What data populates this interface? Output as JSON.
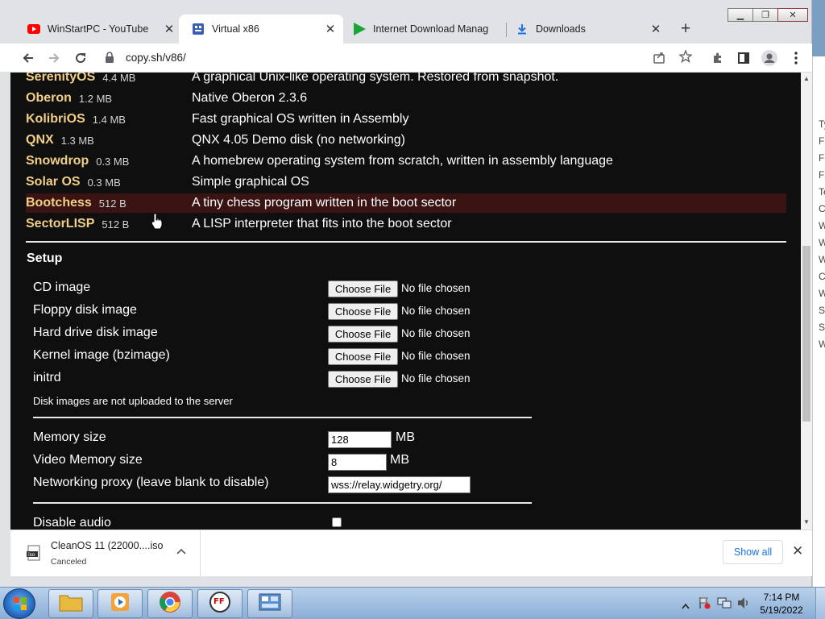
{
  "browser": {
    "tabs": [
      {
        "label": "WinStartPC - YouTube",
        "icon": "youtube-icon"
      },
      {
        "label": "Virtual x86",
        "icon": "v86-icon",
        "active": true
      },
      {
        "label": "Internet Download Manag",
        "icon": "idm-play-icon"
      },
      {
        "label": "Downloads",
        "icon": "download-icon"
      }
    ],
    "url": "copy.sh/v86/"
  },
  "os_list": [
    {
      "name": "SerenityOS",
      "size": "4.4 MB",
      "desc": "A graphical Unix-like operating system. Restored from snapshot."
    },
    {
      "name": "Oberon",
      "size": "1.2 MB",
      "desc": "Native Oberon 2.3.6"
    },
    {
      "name": "KolibriOS",
      "size": "1.4 MB",
      "desc": "Fast graphical OS written in Assembly"
    },
    {
      "name": "QNX",
      "size": "1.3 MB",
      "desc": "QNX 4.05 Demo disk (no networking)"
    },
    {
      "name": "Snowdrop",
      "size": "0.3 MB",
      "desc": "A homebrew operating system from scratch, written in assembly language"
    },
    {
      "name": "Solar OS",
      "size": "0.3 MB",
      "desc": "Simple graphical OS"
    },
    {
      "name": "Bootchess",
      "size": "512 B",
      "desc": "A tiny chess program written in the boot sector",
      "highlighted": true
    },
    {
      "name": "SectorLISP",
      "size": "512 B",
      "desc": "A LISP interpreter that fits into the boot sector"
    }
  ],
  "setup": {
    "title": "Setup",
    "files": [
      {
        "label": "CD image",
        "button": "Choose File",
        "status": "No file chosen"
      },
      {
        "label": "Floppy disk image",
        "button": "Choose File",
        "status": "No file chosen"
      },
      {
        "label": "Hard drive disk image",
        "button": "Choose File",
        "status": "No file chosen"
      },
      {
        "label": "Kernel image (bzimage)",
        "button": "Choose File",
        "status": "No file chosen"
      },
      {
        "label": "initrd",
        "button": "Choose File",
        "status": "No file chosen"
      }
    ],
    "disk_note": "Disk images are not uploaded to the server",
    "memory_label": "Memory size",
    "memory_value": "128",
    "memory_unit": "MB",
    "video_label": "Video Memory size",
    "video_value": "8",
    "video_unit": "MB",
    "proxy_label": "Networking proxy (leave blank to disable)",
    "proxy_value": "wss://relay.widgetry.org/",
    "audio_label": "Disable audio"
  },
  "download_shelf": {
    "filename": "CleanOS 11 (22000....iso",
    "status": "Canceled",
    "show_all": "Show all"
  },
  "taskbar": {
    "time": "7:14 PM",
    "date": "5/19/2022"
  },
  "background_window": {
    "lines": [
      "Ty",
      "Fi",
      "Fi",
      "Fi",
      "Te",
      "C",
      "W",
      "W",
      "W",
      "C",
      "W",
      "Sh",
      "Sh",
      "W"
    ]
  }
}
